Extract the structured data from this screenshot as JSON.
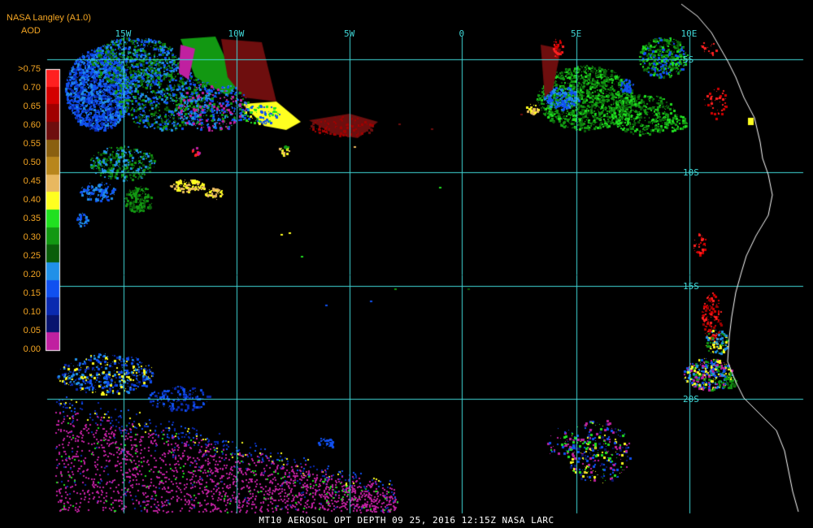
{
  "header": {
    "title": "NASA Langley (A1.0)",
    "subtitle": "AOD",
    "color": "#f5a623"
  },
  "legend": {
    "label_color": "#f5a623",
    "entries": [
      {
        "label": ">0.75",
        "color": "#ff2020"
      },
      {
        "label": "0.70",
        "color": "#d40000"
      },
      {
        "label": "0.65",
        "color": "#a00000"
      },
      {
        "label": "0.60",
        "color": "#6e0e0e"
      },
      {
        "label": "0.55",
        "color": "#8a6010"
      },
      {
        "label": "0.50",
        "color": "#b8861c"
      },
      {
        "label": "0.45",
        "color": "#e8b860"
      },
      {
        "label": "0.40",
        "color": "#ffff20"
      },
      {
        "label": "0.35",
        "color": "#20e020"
      },
      {
        "label": "0.30",
        "color": "#129812"
      },
      {
        "label": "0.25",
        "color": "#0a5e0a"
      },
      {
        "label": "0.20",
        "color": "#2090e8"
      },
      {
        "label": "0.15",
        "color": "#1050f0"
      },
      {
        "label": "0.10",
        "color": "#0a2ab0"
      },
      {
        "label": "0.05",
        "color": "#08146e"
      },
      {
        "label": "0.00",
        "color": "#c020a0"
      }
    ]
  },
  "grid": {
    "color": "#40d8d8",
    "lon_labels": [
      "15W",
      "10W",
      "5W",
      "0",
      "5E",
      "10E"
    ],
    "lat_labels": [
      "5S",
      "10S",
      "15S",
      "20S"
    ]
  },
  "footer": {
    "text": "MT10  AEROSOL OPT DEPTH   09 25, 2016 12:15Z   NASA LARC",
    "color": "#ffffff"
  },
  "coastline_color": "#ffffff"
}
